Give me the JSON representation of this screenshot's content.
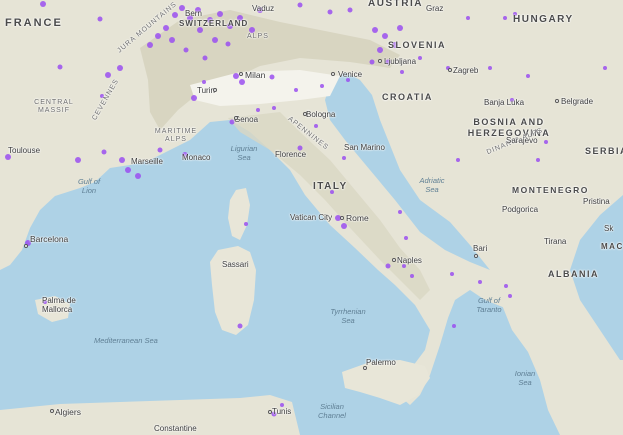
{
  "map": {
    "theme": "topographic base map with occurrence points",
    "colors": {
      "water": "#aed2e6",
      "land": "#e8e6da",
      "italy_land": "#f4f3ec",
      "mountains": "#d9d7c6",
      "point": "#9a4ff0"
    },
    "countries": {
      "france": "FRANCE",
      "austria": "AUSTRIA",
      "hungary": "HUNGARY",
      "slovenia": "SLOVENIA",
      "croatia": "CROATIA",
      "bosnia": "BOSNIA AND HERZEGOVINA",
      "serbia": "SERBIA",
      "montenegro": "MONTENEGRO",
      "italy": "ITALY",
      "albania": "ALBANIA",
      "switzerland": "SWITZERLAND",
      "san_marino": "San Marino",
      "vatican": "Vatican City",
      "macedonia": "MAC"
    },
    "regions": {
      "central_massif": "CENTRAL MASSIF",
      "cevennes": "CEVENNES",
      "maritime_alps": "MARITIME ALPS",
      "jura": "JURA MOUNTAINS",
      "alps": "ALPS",
      "apennines": "APENNINES",
      "dinaric_alps": "DINARIC ALPS"
    },
    "seas": {
      "ligurian": "Ligurian Sea",
      "gulf_lion": "Gulf of Lion",
      "adriatic": "Adriatic Sea",
      "tyrrhenian": "Tyrrhenian Sea",
      "mediterranean": "Mediterranean Sea",
      "ionian": "Ionian Sea",
      "gulf_taranto": "Gulf of Taranto",
      "sicilian_channel": "Sicilian Channel"
    },
    "cities": {
      "bern": "Bern",
      "vaduz": "Vaduz",
      "graz": "Graz",
      "ljubljana": "Ljubljana",
      "zagreb": "Zagreb",
      "banja_luka": "Banja Luka",
      "belgrade": "Belgrade",
      "sarajevo": "Sarajevo",
      "milan": "Milan",
      "venice": "Venice",
      "turin": "Turin",
      "bologna": "Bologna",
      "genoa": "Genoa",
      "florence": "Florence",
      "monaco": "Monaco",
      "marseille": "Marseille",
      "toulouse": "Toulouse",
      "rome": "Rome",
      "podgorica": "Podgorica",
      "pristina": "Pristina",
      "skopje": "Sk",
      "tirana": "Tirana",
      "bari": "Bari",
      "naples": "Naples",
      "barcelona": "Barcelona",
      "sassari": "Sassari",
      "palma": "Palma de\nMallorca",
      "palermo": "Palermo",
      "algiers": "Algiers",
      "tunis": "Tunis",
      "constantine": "Constantine"
    }
  }
}
